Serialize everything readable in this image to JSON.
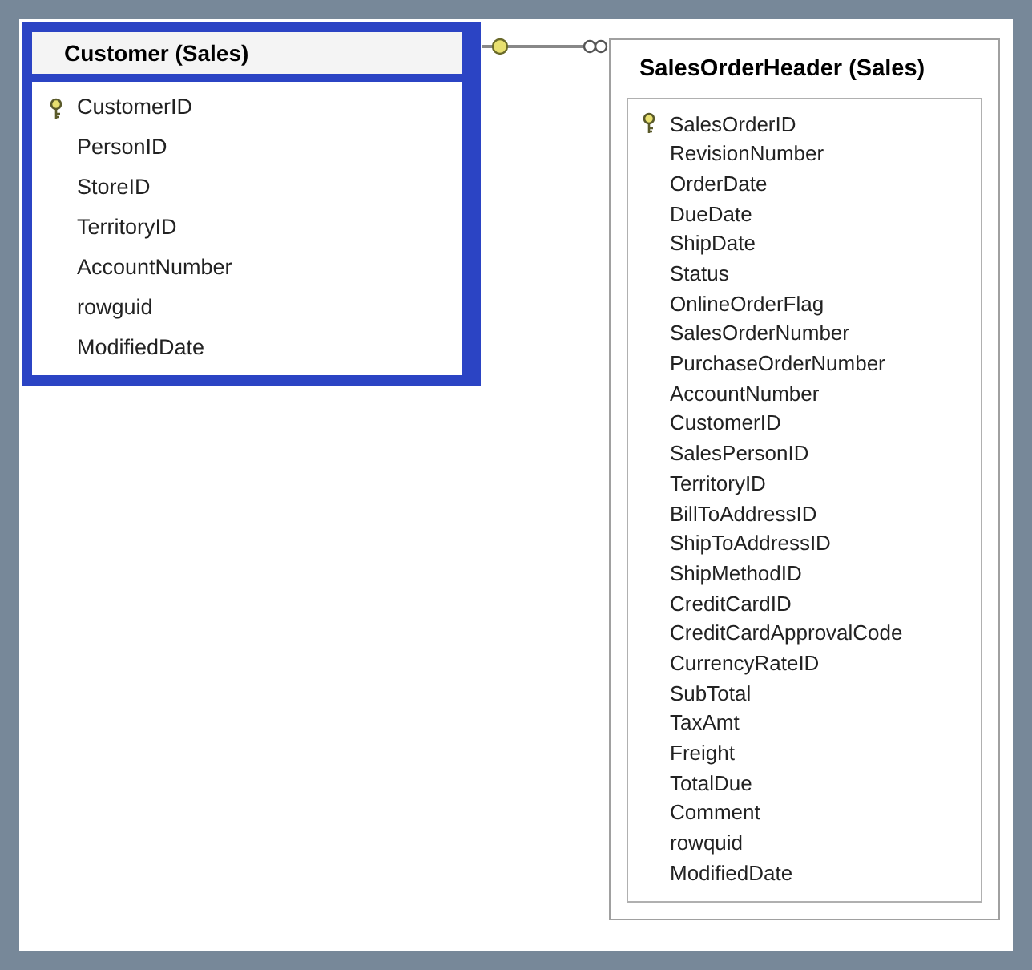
{
  "tables": [
    {
      "title": "Customer (Sales)",
      "selected": true,
      "columns": [
        {
          "name": "CustomerID",
          "primary_key": true
        },
        {
          "name": "PersonID",
          "primary_key": false
        },
        {
          "name": "StoreID",
          "primary_key": false
        },
        {
          "name": "TerritoryID",
          "primary_key": false
        },
        {
          "name": "AccountNumber",
          "primary_key": false
        },
        {
          "name": "rowguid",
          "primary_key": false
        },
        {
          "name": "ModifiedDate",
          "primary_key": false
        }
      ]
    },
    {
      "title": "SalesOrderHeader (Sales)",
      "selected": false,
      "columns": [
        {
          "name": "SalesOrderID",
          "primary_key": true
        },
        {
          "name": "RevisionNumber",
          "primary_key": false
        },
        {
          "name": "OrderDate",
          "primary_key": false
        },
        {
          "name": "DueDate",
          "primary_key": false
        },
        {
          "name": "ShipDate",
          "primary_key": false
        },
        {
          "name": "Status",
          "primary_key": false
        },
        {
          "name": "OnlineOrderFlag",
          "primary_key": false
        },
        {
          "name": "SalesOrderNumber",
          "primary_key": false
        },
        {
          "name": "PurchaseOrderNumber",
          "primary_key": false
        },
        {
          "name": "AccountNumber",
          "primary_key": false
        },
        {
          "name": "CustomerID",
          "primary_key": false
        },
        {
          "name": "SalesPersonID",
          "primary_key": false
        },
        {
          "name": "TerritoryID",
          "primary_key": false
        },
        {
          "name": "BillToAddressID",
          "primary_key": false
        },
        {
          "name": "ShipToAddressID",
          "primary_key": false
        },
        {
          "name": "ShipMethodID",
          "primary_key": false
        },
        {
          "name": "CreditCardID",
          "primary_key": false
        },
        {
          "name": "CreditCardApprovalCode",
          "primary_key": false
        },
        {
          "name": "CurrencyRateID",
          "primary_key": false
        },
        {
          "name": "SubTotal",
          "primary_key": false
        },
        {
          "name": "TaxAmt",
          "primary_key": false
        },
        {
          "name": "Freight",
          "primary_key": false
        },
        {
          "name": "TotalDue",
          "primary_key": false
        },
        {
          "name": "Comment",
          "primary_key": false
        },
        {
          "name": "rowquid",
          "primary_key": false
        },
        {
          "name": "ModifiedDate",
          "primary_key": false
        }
      ]
    }
  ]
}
